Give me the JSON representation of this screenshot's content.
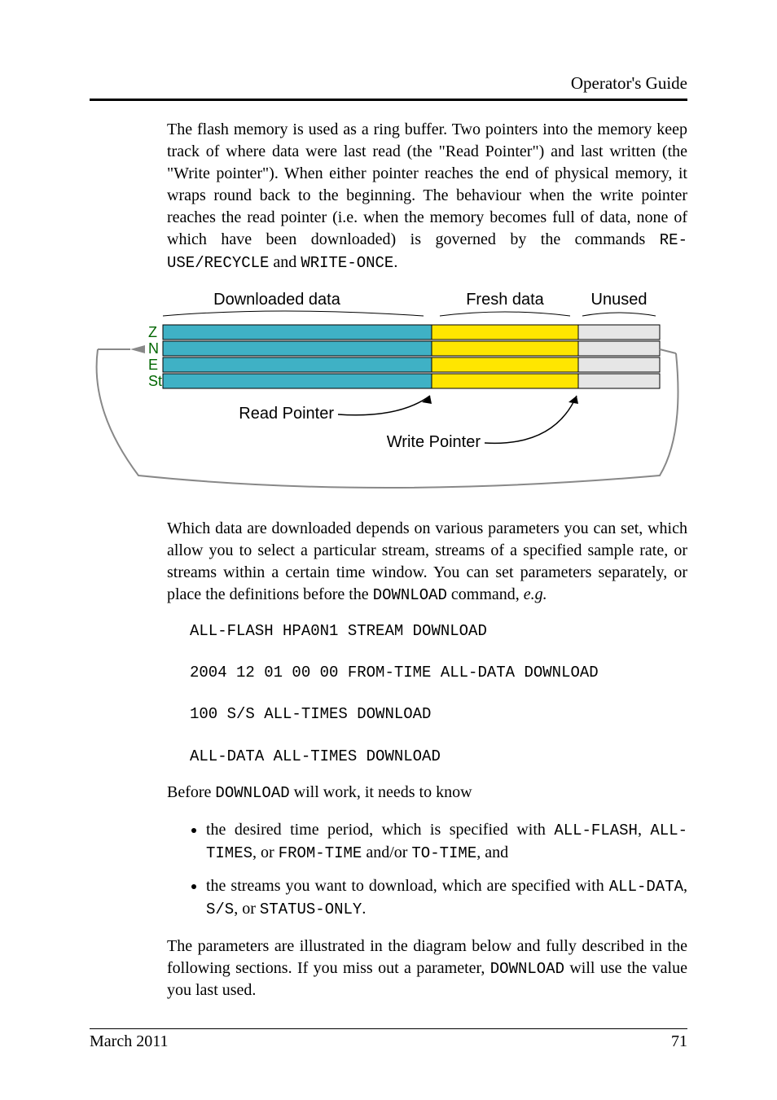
{
  "header": {
    "title": "Operator's Guide"
  },
  "body": {
    "para1_a": "The flash memory is used as a ring buffer.  Two pointers into the memory keep track of where data were last read (the \"Read Pointer\") and last written (the \"Write pointer\").  When either pointer reaches the end of physical memory, it wraps round back to the beginning.  The behaviour when the write pointer reaches the read pointer (i.e. when the memory becomes full of data, none of which have been downloaded) is governed by the commands ",
    "cmd_reuse": "RE-USE/RECYCLE",
    "para1_b": " and ",
    "cmd_writeonce": "WRITE-ONCE",
    "para1_c": ".",
    "diagram": {
      "label_downloaded": "Downloaded data",
      "label_fresh": "Fresh data",
      "label_unused": "Unused",
      "row_z": "Z",
      "row_n": "N",
      "row_e": "E",
      "row_status": "Status",
      "read_pointer": "Read Pointer",
      "write_pointer": "Write Pointer"
    },
    "para2_a": "Which data are downloaded depends on various parameters you can set, which allow you to select a particular stream, streams of a specified sample rate, or streams within a certain time window.  You can set parameters separately, or place the definitions before the ",
    "cmd_download": "DOWNLOAD",
    "para2_b": " command, ",
    "para2_eg": "e.g.",
    "code": {
      "l1": "ALL-FLASH HPA0N1 STREAM DOWNLOAD",
      "l2": "2004 12 01 00 00 FROM-TIME ALL-DATA DOWNLOAD",
      "l3": "100 S/S ALL-TIMES DOWNLOAD",
      "l4": "ALL-DATA ALL-TIMES DOWNLOAD"
    },
    "para3_a": "Before ",
    "para3_b": " will work, it needs to know",
    "bullet1_a": "the desired time period, which is specified with ",
    "cmd_allflash": "ALL-FLASH",
    "bullet1_b": ", ",
    "cmd_alltimes": "ALL-TIMES",
    "bullet1_c": ", or ",
    "cmd_fromtime": "FROM-TIME",
    "bullet1_d": " and/or ",
    "cmd_totime": "TO-TIME",
    "bullet1_e": ",  and",
    "bullet2_a": "the streams you want to download, which are specified with ",
    "cmd_alldata": "ALL-DATA",
    "bullet2_b": ", ",
    "cmd_ss": "S/S",
    "bullet2_c": ", or ",
    "cmd_statusonly": "STATUS-ONLY",
    "bullet2_d": ".",
    "para4_a": "The parameters are illustrated in the diagram below and fully described in the following sections.  If you miss out a parameter, ",
    "para4_b": " will use the value you last used."
  },
  "footer": {
    "date": "March 2011",
    "page": "71"
  }
}
